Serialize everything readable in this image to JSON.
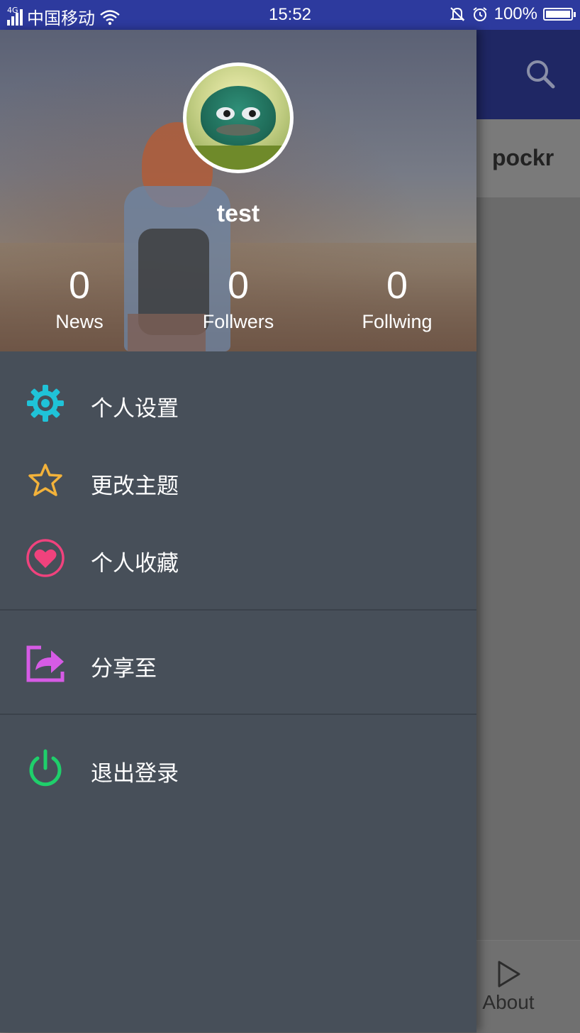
{
  "status_bar": {
    "network": "4G",
    "carrier": "中国移动",
    "time": "15:52",
    "battery": "100%"
  },
  "background_app": {
    "tab_text": "pockr",
    "bottom_nav_label": "About"
  },
  "drawer": {
    "username": "test",
    "stats": [
      {
        "value": "0",
        "label": "News"
      },
      {
        "value": "0",
        "label": "Follwers"
      },
      {
        "value": "0",
        "label": "Follwing"
      }
    ],
    "menu": [
      {
        "label": "个人设置",
        "icon": "gear-icon",
        "color": "#1fc3d8"
      },
      {
        "label": "更改主题",
        "icon": "star-icon",
        "color": "#f3b23a"
      },
      {
        "label": "个人收藏",
        "icon": "heart-icon",
        "color": "#f0427d"
      },
      {
        "label": "分享至",
        "icon": "share-icon",
        "color": "#d65be5"
      },
      {
        "label": "退出登录",
        "icon": "power-icon",
        "color": "#1fcf6b"
      }
    ]
  },
  "colors": {
    "status_bar": "#2d3a9e",
    "drawer_bg": "#474f59",
    "toolbar": "#1f2764"
  }
}
